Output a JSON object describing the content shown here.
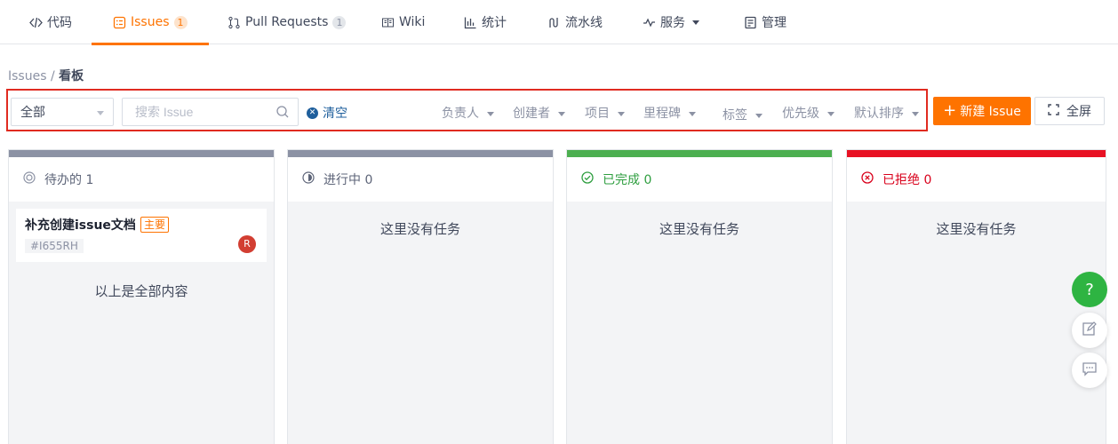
{
  "nav": {
    "tabs": [
      {
        "label": "代码",
        "icon": "code-icon"
      },
      {
        "label": "Issues",
        "badge": "1",
        "icon": "issues-icon",
        "active": true
      },
      {
        "label": "Pull Requests",
        "badge": "1",
        "icon": "pull-request-icon"
      },
      {
        "label": "Wiki",
        "icon": "wiki-icon"
      },
      {
        "label": "统计",
        "icon": "stats-icon"
      },
      {
        "label": "流水线",
        "icon": "pipeline-icon"
      },
      {
        "label": "服务",
        "icon": "service-icon"
      },
      {
        "label": "管理",
        "icon": "manage-icon"
      }
    ]
  },
  "breadcrumb": {
    "root": "Issues",
    "sep": " / ",
    "current": "看板"
  },
  "filters": {
    "scope": "全部",
    "search_placeholder": "搜索 Issue",
    "clear": "清空",
    "dropdowns": [
      "负责人",
      "创建者",
      "项目",
      "里程碑",
      "标签",
      "优先级",
      "默认排序"
    ]
  },
  "actions": {
    "new_issue": "新建 Issue",
    "fullscreen": "全屏"
  },
  "columns": [
    {
      "title": "待办的 1",
      "color": "#8c92a4"
    },
    {
      "title": "进行中 0",
      "color": "#8c92a4"
    },
    {
      "title": "已完成 0",
      "color": "#4caf50"
    },
    {
      "title": "已拒绝 0",
      "color": "#e81123"
    }
  ],
  "card": {
    "title": "补充创建issue文档",
    "tag": "主要",
    "number": "#I655RH",
    "avatar": "R"
  },
  "empty_text": "这里没有任务",
  "end_text": "以上是全部内容",
  "help": "?"
}
